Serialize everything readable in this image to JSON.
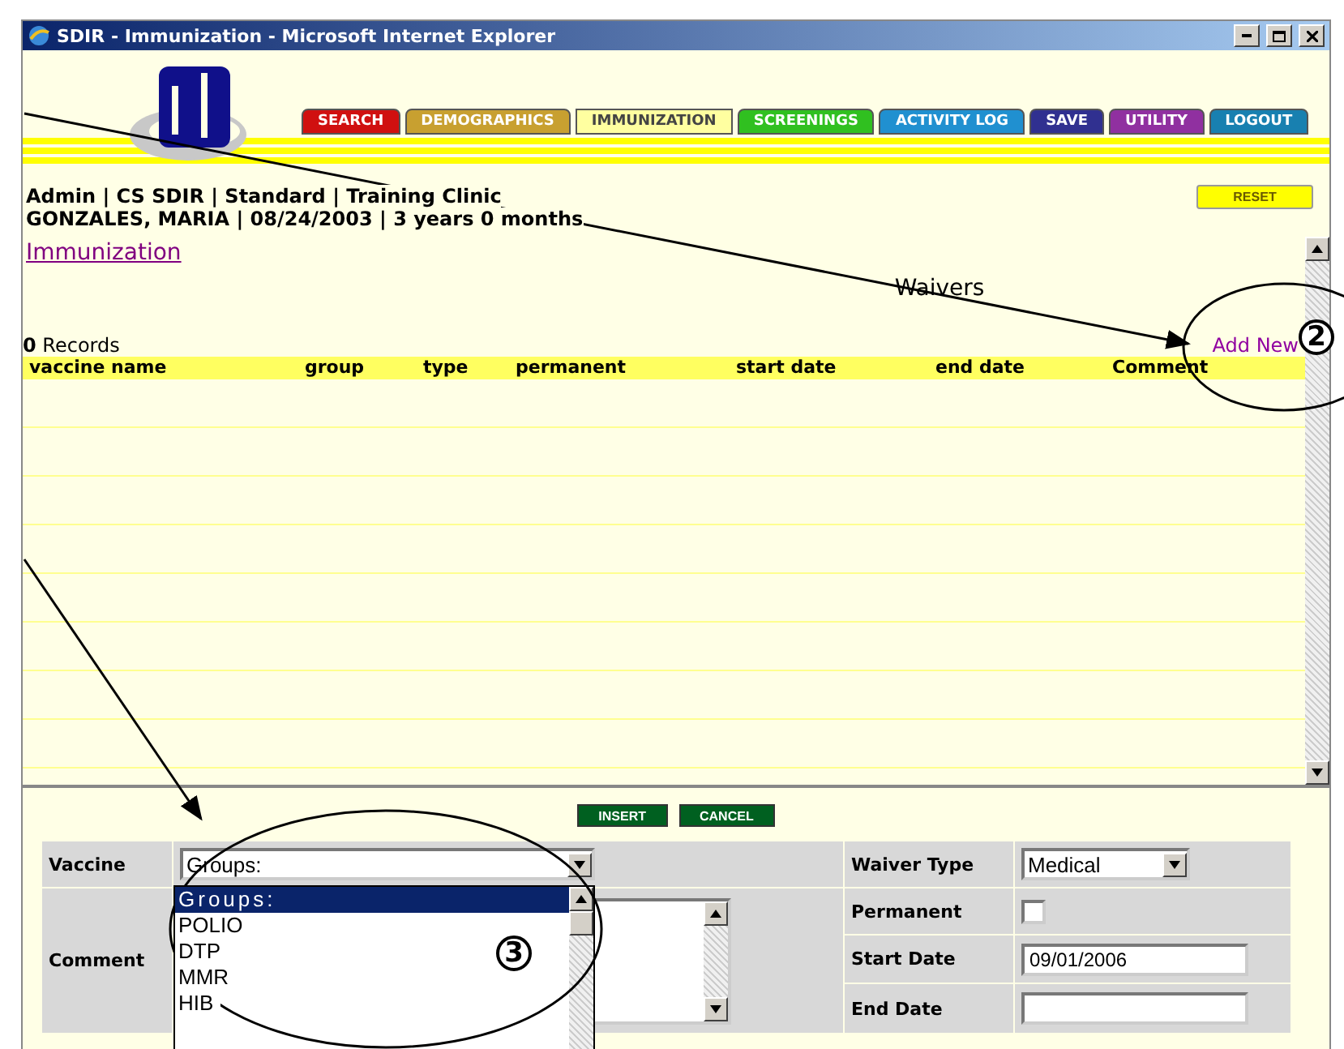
{
  "window": {
    "title": "SDIR - Immunization - Microsoft Internet Explorer"
  },
  "nav_tabs": [
    {
      "label": "SEARCH",
      "color": "#d01010",
      "selected": false
    },
    {
      "label": "DEMOGRAPHICS",
      "color": "#c8a030",
      "selected": false
    },
    {
      "label": "IMMUNIZATION",
      "color": "#ffffa0",
      "selected": true
    },
    {
      "label": "SCREENINGS",
      "color": "#30c020",
      "selected": false
    },
    {
      "label": "ACTIVITY LOG",
      "color": "#2090d0",
      "selected": false
    },
    {
      "label": "SAVE",
      "color": "#303090",
      "selected": false
    },
    {
      "label": "UTILITY",
      "color": "#9030a0",
      "selected": false
    },
    {
      "label": "LOGOUT",
      "color": "#1880b0",
      "selected": false
    }
  ],
  "reset_button": "RESET",
  "user_info": [
    "Admin | CS SDIR | Standard | Training Clinic",
    "GONZALES, MARIA | 08/24/2003 | 3 years 0 months"
  ],
  "section_link": "Immunization",
  "waivers": {
    "title": "Waivers",
    "record_count": "**0** Records",
    "add_new": "Add New",
    "columns": [
      "vaccine name",
      "group",
      "type",
      "permanent",
      "start date",
      "end date",
      "Comment"
    ]
  },
  "form_buttons": [
    "INSERT",
    "CANCEL"
  ],
  "form": {
    "vaccine_label": "Vaccine",
    "vaccine_value": "Groups:",
    "comment_label": "Comment",
    "waiver_type_label": "Waiver Type",
    "waiver_type_value": "Medical",
    "permanent_label": "Permanent",
    "permanent_checked": false,
    "start_date_label": "Start Date",
    "start_date_value": "09/01/2006",
    "end_date_label": "End Date"
  },
  "vaccine_options": [
    {
      "label": "Groups:",
      "selected": true
    },
    {
      "label": "POLIO",
      "selected": false
    },
    {
      "label": "DTP",
      "selected": false
    },
    {
      "label": "MMR",
      "selected": false
    },
    {
      "label": "HIB",
      "selected": false
    }
  ],
  "callouts": [
    "2",
    "3"
  ]
}
